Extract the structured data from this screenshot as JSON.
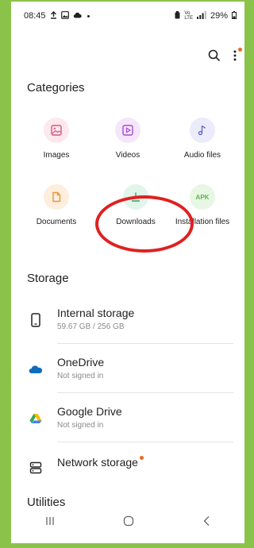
{
  "status_bar": {
    "time": "08:45",
    "signal_text": "",
    "battery": "29%"
  },
  "header": {
    "search_icon": "search-icon",
    "more_icon": "more-vert-icon"
  },
  "categories": {
    "title": "Categories",
    "items": [
      {
        "label": "Images",
        "icon": "image-icon",
        "color": "#d6577a",
        "bg": "#fde8ee"
      },
      {
        "label": "Videos",
        "icon": "video-icon",
        "color": "#a64bd0",
        "bg": "#f4e6fb"
      },
      {
        "label": "Audio files",
        "icon": "music-note-icon",
        "color": "#5b5ad6",
        "bg": "#ebebfb"
      },
      {
        "label": "Documents",
        "icon": "document-icon",
        "color": "#e8953c",
        "bg": "#fdeedd"
      },
      {
        "label": "Downloads",
        "icon": "download-icon",
        "color": "#2aa56c",
        "bg": "#e2f5ea"
      },
      {
        "label": "Installation files",
        "icon": "apk-icon",
        "icon_text": "APK",
        "color": "#5cb54b",
        "bg": "#e8f7e4"
      }
    ]
  },
  "storage": {
    "title": "Storage",
    "items": [
      {
        "title": "Internal storage",
        "sub": "59.67 GB / 256 GB",
        "icon": "phone-icon"
      },
      {
        "title": "OneDrive",
        "sub": "Not signed in",
        "icon": "onedrive-icon"
      },
      {
        "title": "Google Drive",
        "sub": "Not signed in",
        "icon": "google-drive-icon"
      },
      {
        "title": "Network storage",
        "sub": "",
        "icon": "network-storage-icon"
      }
    ]
  },
  "utilities": {
    "title": "Utilities"
  },
  "colors": {
    "accent_orange": "#e86b28",
    "highlight_red": "#e02020"
  }
}
